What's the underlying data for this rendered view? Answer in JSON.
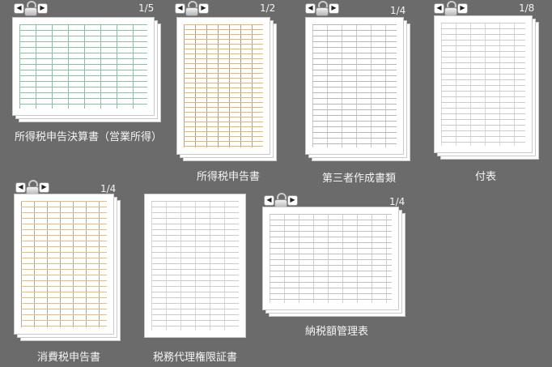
{
  "thumbnails": [
    {
      "label": "所得税申告決算書（営業所得）",
      "pages": "1/5",
      "theme": "#2e8b57"
    },
    {
      "label": "所得税申告書",
      "pages": "1/2",
      "theme": "#d48a00"
    },
    {
      "label": "第三者作成書類",
      "pages": "1/4",
      "theme": "#555555"
    },
    {
      "label": "付表",
      "pages": "1/8",
      "theme": "#555555"
    },
    {
      "label": "消費税申告書",
      "pages": "1/4",
      "theme": "#d48a00"
    },
    {
      "label": "税務代理権限証書",
      "pages": "",
      "theme": "#555555"
    },
    {
      "label": "納税額管理表",
      "pages": "1/4",
      "theme": "#555555"
    }
  ],
  "icons": {
    "prev": "◀",
    "next": "▶"
  }
}
